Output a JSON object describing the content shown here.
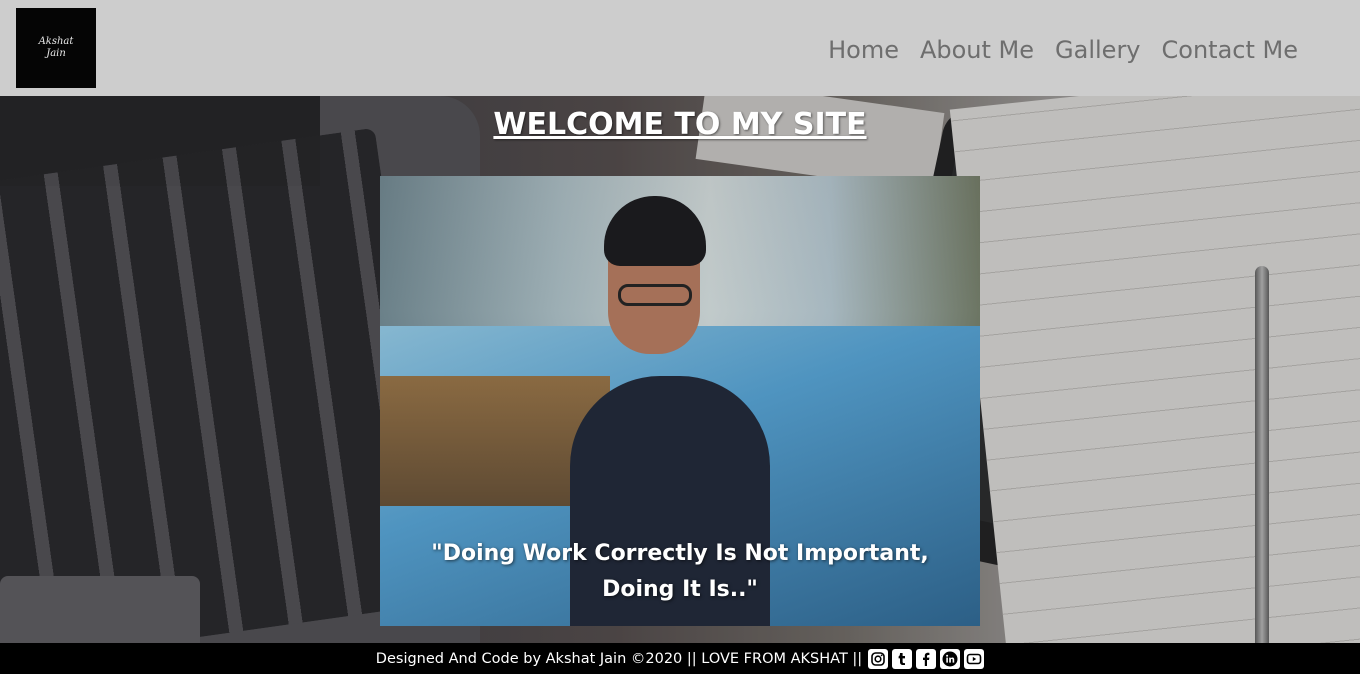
{
  "header": {
    "logo_line1": "Akshat",
    "logo_line2": "Jain",
    "nav": [
      {
        "label": "Home"
      },
      {
        "label": "About Me"
      },
      {
        "label": "Gallery"
      },
      {
        "label": "Contact Me"
      }
    ]
  },
  "hero": {
    "title": "WELCOME TO MY SITE",
    "quote": "\"Doing Work Correctly Is Not Important, Doing It Is..\""
  },
  "footer": {
    "text": "Designed And Code by Akshat Jain ©2020 || LOVE FROM AKSHAT ||",
    "social_icons": [
      "instagram-icon",
      "tumblr-icon",
      "facebook-icon",
      "linkedin-icon",
      "youtube-icon"
    ]
  }
}
